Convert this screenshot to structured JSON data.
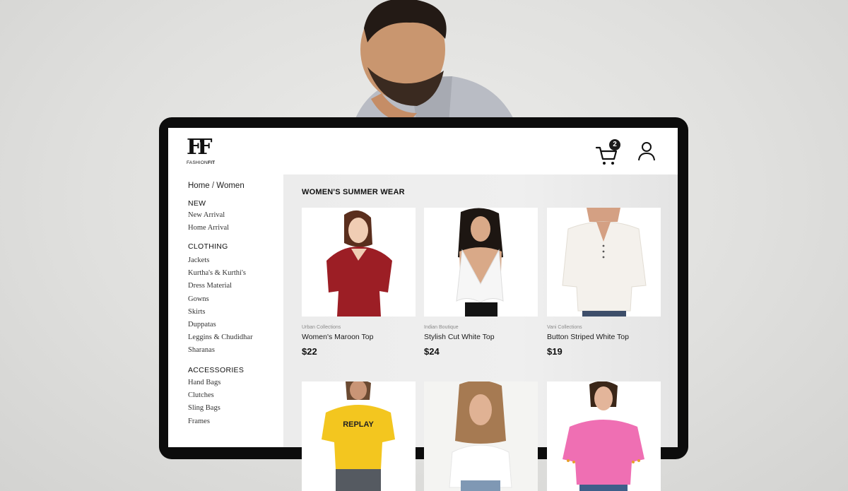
{
  "header": {
    "logo_mark": "FF",
    "logo_text_a": "FASHION",
    "logo_text_b": "FIT",
    "cart_count": "2"
  },
  "breadcrumb": {
    "home": "Home",
    "separator": "/",
    "current": "Women"
  },
  "sidebar": {
    "groups": [
      {
        "title": "NEW",
        "items": [
          "New Arrival",
          "Home Arrival"
        ]
      },
      {
        "title": "CLOTHING",
        "items": [
          "Jackets",
          "Kurtha's & Kurthi's",
          "Dress Material",
          "Gowns",
          "Skirts",
          "Duppatas",
          "Leggins & Chudidhar",
          "Sharanas"
        ]
      },
      {
        "title": "ACCESSORIES",
        "items": [
          "Hand Bags",
          "Clutches",
          "Sling Bags",
          "Frames"
        ]
      }
    ]
  },
  "main": {
    "title": "WOMEN'S SUMMER WEAR",
    "products": [
      {
        "brand": "Urban Collections",
        "name": "Women's Maroon Top",
        "price": "$22",
        "color": "#8e1d22"
      },
      {
        "brand": "Indian Boutique",
        "name": "Stylish Cut White Top",
        "price": "$24",
        "color": "#f4f4f4"
      },
      {
        "brand": "Vani Collections",
        "name": "Button Striped White Top",
        "price": "$19",
        "color": "#f2efe9"
      }
    ],
    "products_row2": [
      {
        "color": "#f2c623",
        "print": "REPLAY"
      },
      {
        "color": "#f7f7f7"
      },
      {
        "color": "#f06ab0"
      }
    ]
  }
}
